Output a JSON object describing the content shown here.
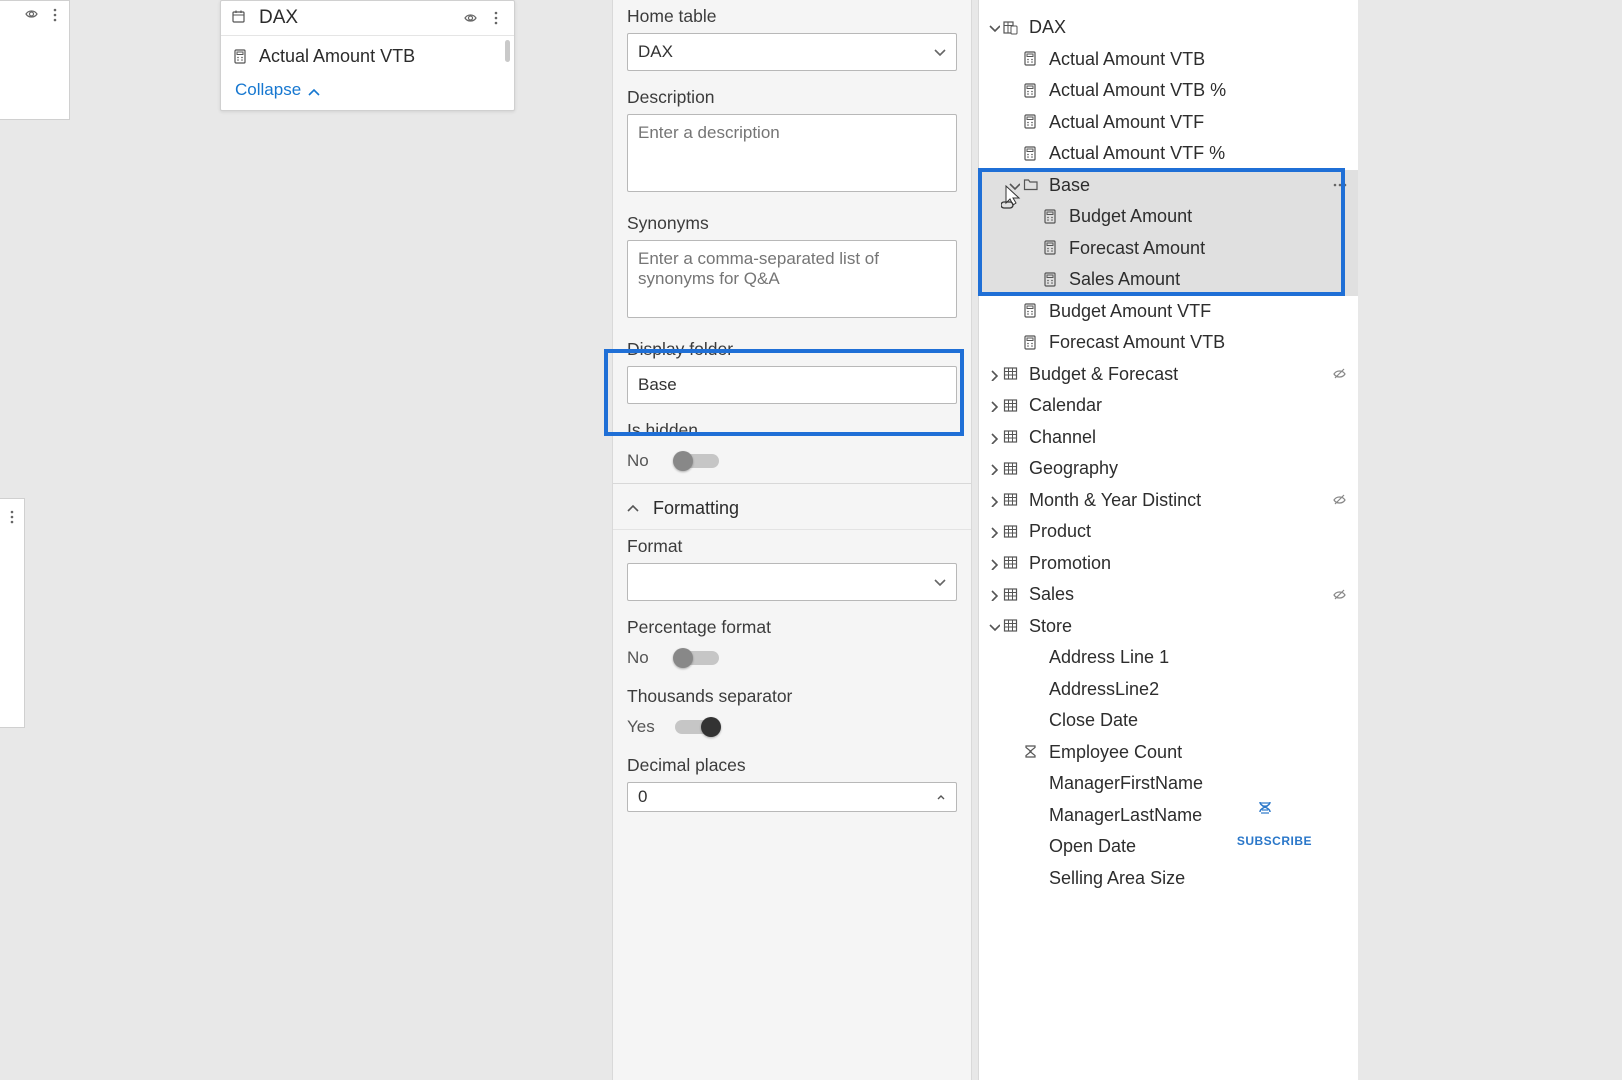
{
  "canvas": {
    "stub_left": {
      "has_eye": true
    },
    "dax_card": {
      "title": "DAX",
      "field_name": "Actual Amount VTB",
      "collapse_label": "Collapse"
    }
  },
  "properties": {
    "home_table_label": "Home table",
    "home_table_value": "DAX",
    "description_label": "Description",
    "description_placeholder": "Enter a description",
    "synonyms_label": "Synonyms",
    "synonyms_placeholder": "Enter a comma-separated list of synonyms for Q&A",
    "display_folder_label": "Display folder",
    "display_folder_value": "Base",
    "is_hidden_label": "Is hidden",
    "is_hidden_value": "No",
    "formatting_header": "Formatting",
    "format_label": "Format",
    "format_value": "",
    "percentage_label": "Percentage format",
    "percentage_value": "No",
    "thousands_label": "Thousands separator",
    "thousands_value": "Yes",
    "decimal_label": "Decimal places",
    "decimal_value": "0"
  },
  "fields": {
    "dax_table": "DAX",
    "dax_measures": [
      "Actual Amount VTB",
      "Actual Amount VTB %",
      "Actual Amount VTF",
      "Actual Amount VTF %"
    ],
    "base_folder": "Base",
    "base_children": [
      "Budget Amount",
      "Forecast Amount",
      "Sales Amount"
    ],
    "dax_measures_after": [
      "Budget Amount VTF",
      "Forecast Amount VTB"
    ],
    "tables_collapsed": [
      "Budget & Forecast",
      "Calendar",
      "Channel",
      "Geography",
      "Month & Year Distinct",
      "Product",
      "Promotion",
      "Sales"
    ],
    "hidden_tables": [
      "Budget & Forecast",
      "Month & Year Distinct",
      "Sales"
    ],
    "store_table": "Store",
    "store_columns": [
      "Address Line 1",
      "AddressLine2",
      "Close Date",
      "Employee Count",
      "ManagerFirstName",
      "ManagerLastName",
      "Open Date",
      "Selling Area Size"
    ],
    "store_sigma_cols": [
      "Employee Count"
    ]
  },
  "subscribe_label": "SUBSCRIBE"
}
